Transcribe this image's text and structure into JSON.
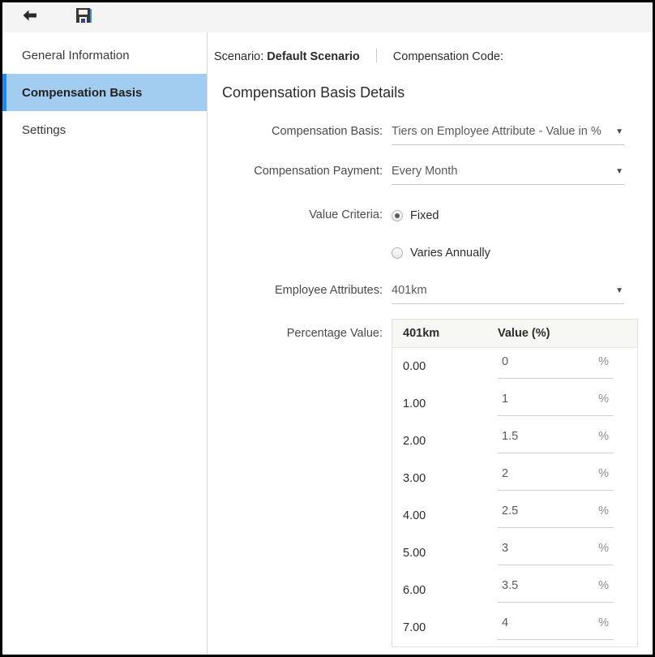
{
  "toolbar": {
    "back_icon": "back-arrow-icon",
    "save_icon": "floppy-disk-save-icon"
  },
  "sidebar": {
    "items": [
      {
        "label": "General Information",
        "selected": false
      },
      {
        "label": "Compensation Basis",
        "selected": true
      },
      {
        "label": "Settings",
        "selected": false
      }
    ]
  },
  "breadcrumb": {
    "scenario_label": "Scenario:",
    "scenario_value": "Default Scenario",
    "compensation_code_label": "Compensation Code:",
    "compensation_code_value": ""
  },
  "main": {
    "page_title": "Compensation Basis Details"
  },
  "form": {
    "compensation_basis": {
      "label": "Compensation Basis:",
      "value": "Tiers on Employee Attribute - Value in %"
    },
    "compensation_payment": {
      "label": "Compensation Payment:",
      "value": "Every Month"
    },
    "value_criteria": {
      "label": "Value Criteria:",
      "option_fixed": "Fixed",
      "option_varies": "Varies Annually",
      "selected": "Fixed"
    },
    "employee_attributes": {
      "label": "Employee Attributes:",
      "value": "401km"
    },
    "percentage_value": {
      "label": "Percentage Value:"
    }
  },
  "table": {
    "columns": [
      "401km",
      "Value (%)"
    ],
    "unit_suffix": "%",
    "rows": [
      {
        "attribute": "0.00",
        "value": "0"
      },
      {
        "attribute": "1.00",
        "value": "1"
      },
      {
        "attribute": "2.00",
        "value": "1.5"
      },
      {
        "attribute": "3.00",
        "value": "2"
      },
      {
        "attribute": "4.00",
        "value": "2.5"
      },
      {
        "attribute": "5.00",
        "value": "3"
      },
      {
        "attribute": "6.00",
        "value": "3.5"
      },
      {
        "attribute": "7.00",
        "value": "4"
      }
    ]
  },
  "colors": {
    "selection_bg": "#a3cdf0",
    "selection_accent": "#1a8cf0",
    "toolbar_bg": "#f4f4f4",
    "table_header_bg": "#f7f7f4"
  }
}
